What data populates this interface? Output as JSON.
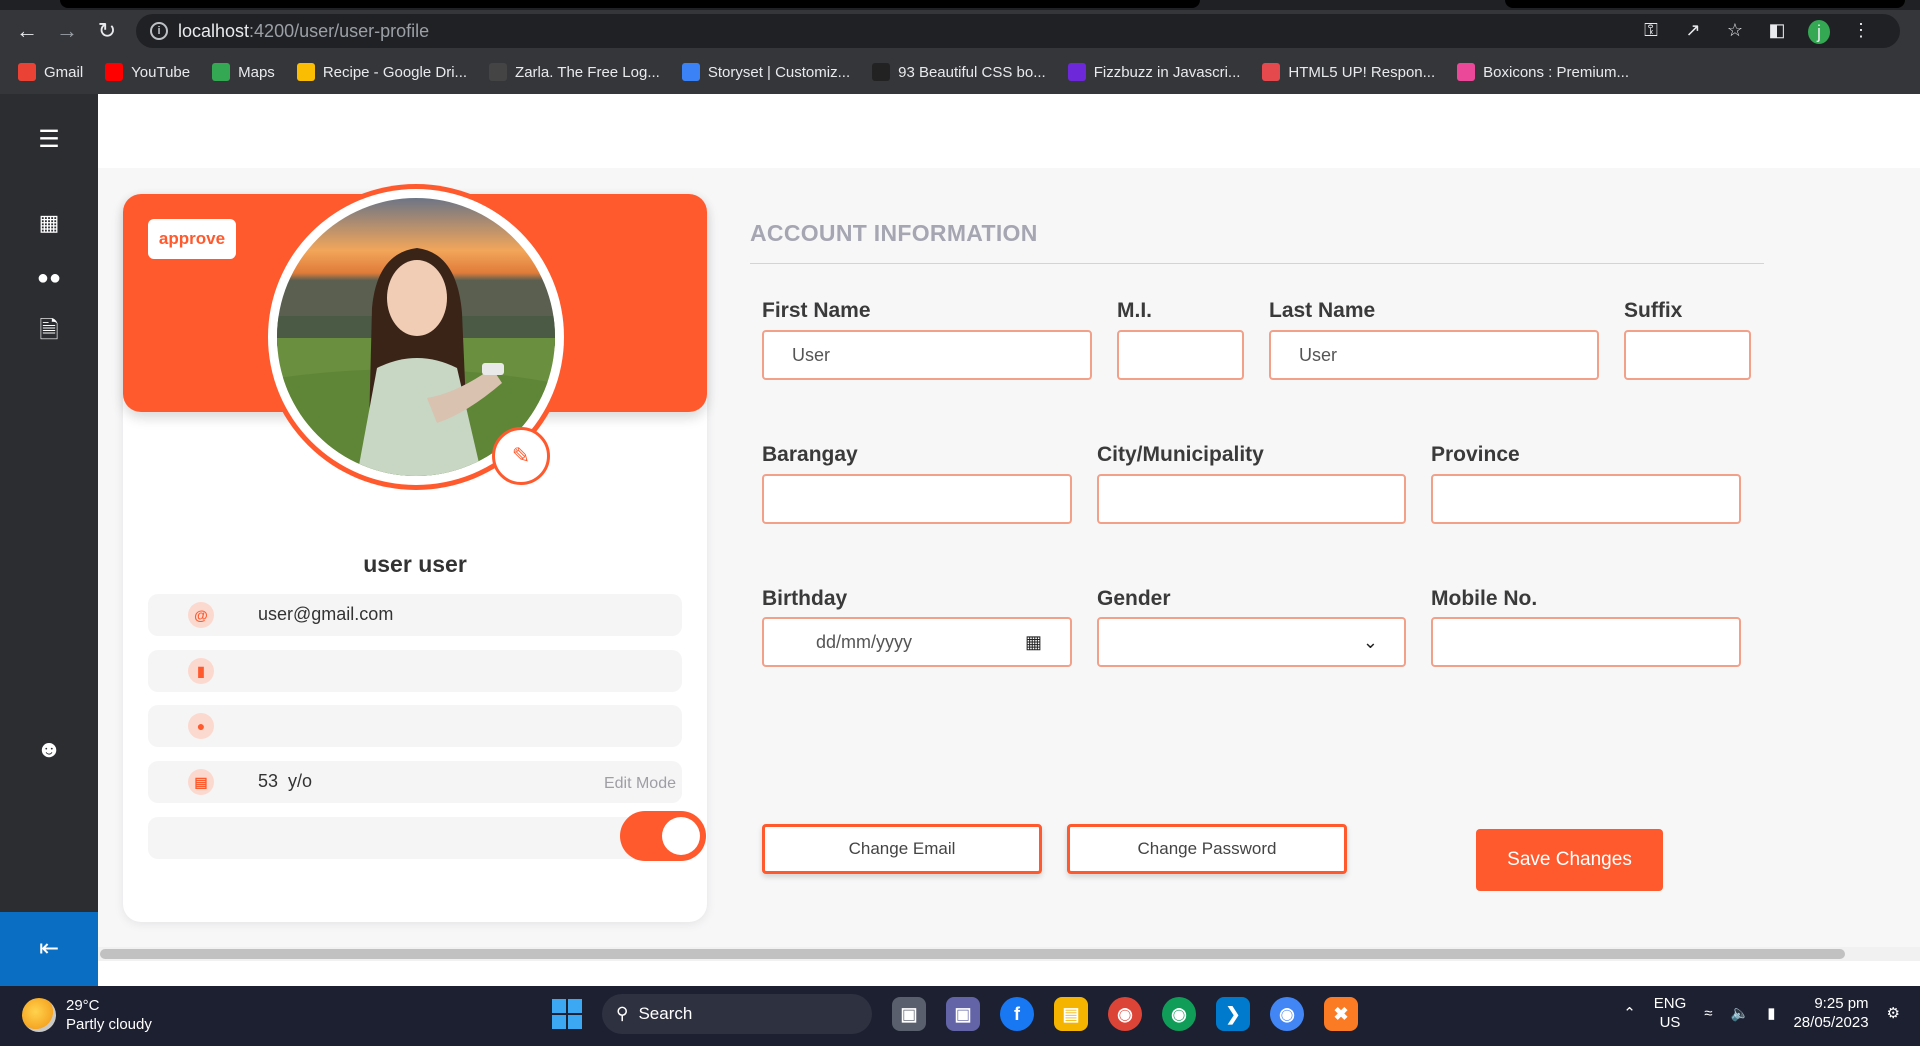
{
  "browser": {
    "url_host": "localhost",
    "url_path": ":4200/user/user-profile",
    "profile_initial": "j",
    "bookmarks": [
      {
        "label": "Gmail",
        "color": "#ea4335"
      },
      {
        "label": "YouTube",
        "color": "#ff0000"
      },
      {
        "label": "Maps",
        "color": "#34a853"
      },
      {
        "label": "Recipe - Google Dri...",
        "color": "#fbbc04"
      },
      {
        "label": "Zarla. The Free Log...",
        "color": "#444444"
      },
      {
        "label": "Storyset | Customiz...",
        "color": "#3b82f6"
      },
      {
        "label": "93 Beautiful CSS bo...",
        "color": "#222222"
      },
      {
        "label": "Fizzbuzz in Javascri...",
        "color": "#6d28d9"
      },
      {
        "label": "HTML5 UP! Respon...",
        "color": "#e5484d"
      },
      {
        "label": "Boxicons : Premium...",
        "color": "#ec4899"
      }
    ]
  },
  "sidebar": {
    "icons": [
      "menu-icon",
      "dashboard-icon",
      "users-icon",
      "document-check-icon",
      "user-icon",
      "logout-icon"
    ]
  },
  "profile": {
    "badge": "approve",
    "name": "user user",
    "email": "user@gmail.com",
    "phone": "",
    "address": "",
    "age_value": "53",
    "age_unit": "y/o",
    "edit_mode_label": "Edit Mode",
    "edit_mode_on": true
  },
  "account": {
    "title": "ACCOUNT INFORMATION",
    "labels": {
      "first_name": "First Name",
      "mi": "M.I.",
      "last_name": "Last Name",
      "suffix": "Suffix",
      "barangay": "Barangay",
      "city": "City/Municipality",
      "province": "Province",
      "birthday": "Birthday",
      "gender": "Gender",
      "mobile": "Mobile No."
    },
    "values": {
      "first_name": "User",
      "mi": "",
      "last_name": "User",
      "suffix": "",
      "barangay": "",
      "city": "",
      "province": "",
      "birthday_placeholder": "dd/mm/yyyy",
      "gender": "",
      "mobile": ""
    },
    "buttons": {
      "change_email": "Change Email",
      "change_password": "Change Password",
      "save": "Save Changes"
    }
  },
  "taskbar": {
    "temp": "29°C",
    "weather": "Partly cloudy",
    "search": "Search",
    "lang_top": "ENG",
    "lang_bottom": "US",
    "time": "9:25 pm",
    "date": "28/05/2023"
  }
}
